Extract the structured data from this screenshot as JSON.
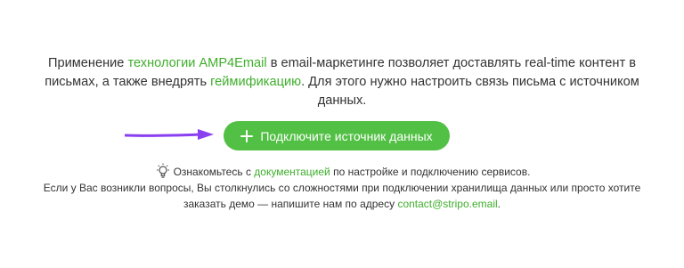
{
  "intro": {
    "part1": "Применение ",
    "link_amp": "технологии AMP4Email",
    "part2": " в email-маркетинге позволяет доставлять real-time контент в письмах, а также внедрять ",
    "link_gamification": "геймификацию",
    "part3": ". Для этого нужно настроить связь письма с источником данных."
  },
  "connect_button": {
    "label": "Подключите источник данных",
    "icon": "plus-icon"
  },
  "arrow": {
    "icon": "arrow-right-icon",
    "color": "#8a3ff0"
  },
  "notes": {
    "icon": "lightbulb-icon",
    "line1_part1": "Ознакомьтесь с ",
    "line1_link": "документацией",
    "line1_part2": " по настройке и подключению сервисов.",
    "line2_part1": "Если у Вас возникли вопросы, Вы столкнулись со сложностями при подключении хранилища данных или просто хотите заказать демо — напишите нам по адресу ",
    "line2_link": "contact@stripo.email",
    "line2_part2": "."
  },
  "colors": {
    "accent_green": "#52c044",
    "link_green": "#3fae2c",
    "arrow_purple": "#8a3ff0",
    "text": "#333333"
  }
}
